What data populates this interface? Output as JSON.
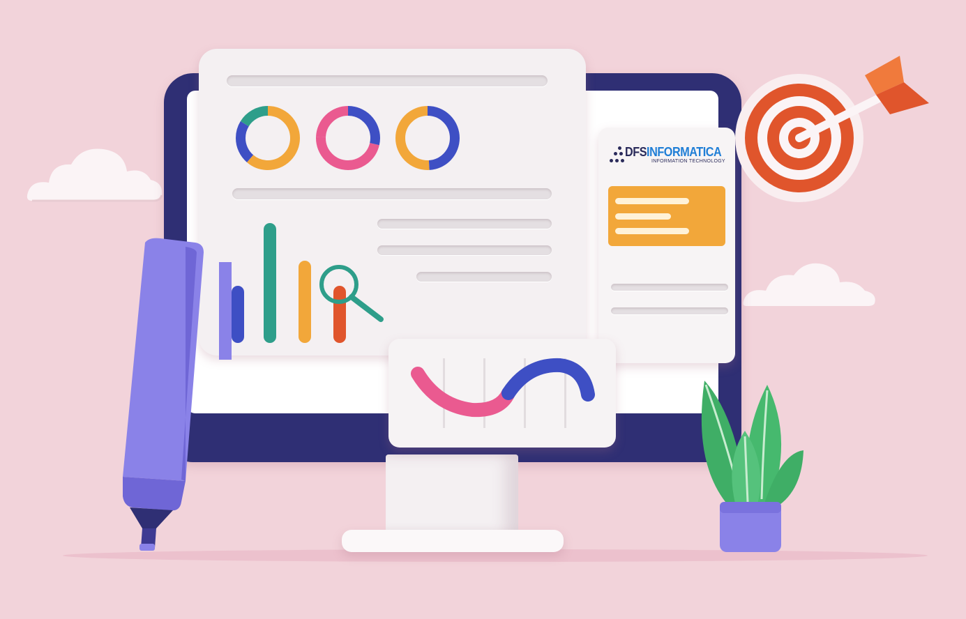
{
  "logo": {
    "brand_prefix": "DFS",
    "brand_suffix": "INFORMATICA",
    "tagline": "INFORMATION TECHNOLOGY"
  },
  "colors": {
    "background": "#f2d3da",
    "monitor_frame": "#2f2f74",
    "accent_orange": "#f2a73a",
    "accent_pink": "#ea5a90",
    "accent_blue": "#3e4fc4",
    "accent_teal": "#2e9e8a",
    "accent_red": "#e0552c",
    "highlighter": "#8a82e8"
  },
  "icons": [
    "donut-chart-icon",
    "bar-chart-icon",
    "magnifier-icon",
    "target-icon",
    "arrow-icon",
    "wave-chart-icon",
    "highlighter-icon",
    "plant-icon",
    "cloud-icon"
  ]
}
